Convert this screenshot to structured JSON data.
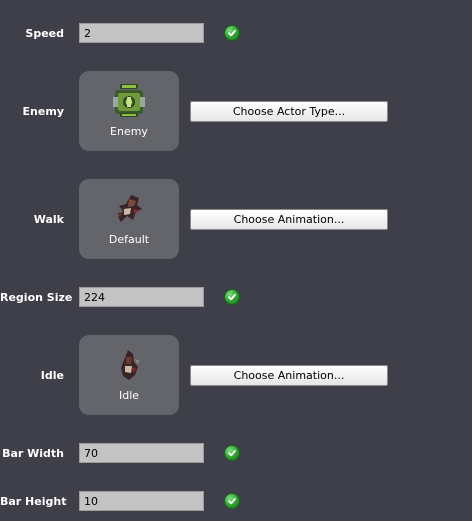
{
  "speed": {
    "label": "Speed",
    "value": "2",
    "status_icon": "check-circle-icon"
  },
  "enemy": {
    "label": "Enemy",
    "tile_caption": "Enemy",
    "tile_icon": "tank-actor-icon",
    "button_label": "Choose Actor Type..."
  },
  "walk": {
    "label": "Walk",
    "tile_caption": "Default",
    "tile_icon": "walk-animation-icon",
    "button_label": "Choose Animation..."
  },
  "region_size": {
    "label": "Region Size",
    "value": "224",
    "status_icon": "check-circle-icon"
  },
  "idle": {
    "label": "Idle",
    "tile_caption": "Idle",
    "tile_icon": "idle-animation-icon",
    "button_label": "Choose Animation..."
  },
  "bar_width": {
    "label": "Bar Width",
    "value": "70",
    "status_icon": "check-circle-icon"
  },
  "bar_height": {
    "label": "Bar Height",
    "value": "10",
    "status_icon": "check-circle-icon"
  },
  "colors": {
    "background": "#3e3f49",
    "tile": "#64656b",
    "field": "#c3c3c3",
    "check": "#2ea02e"
  }
}
